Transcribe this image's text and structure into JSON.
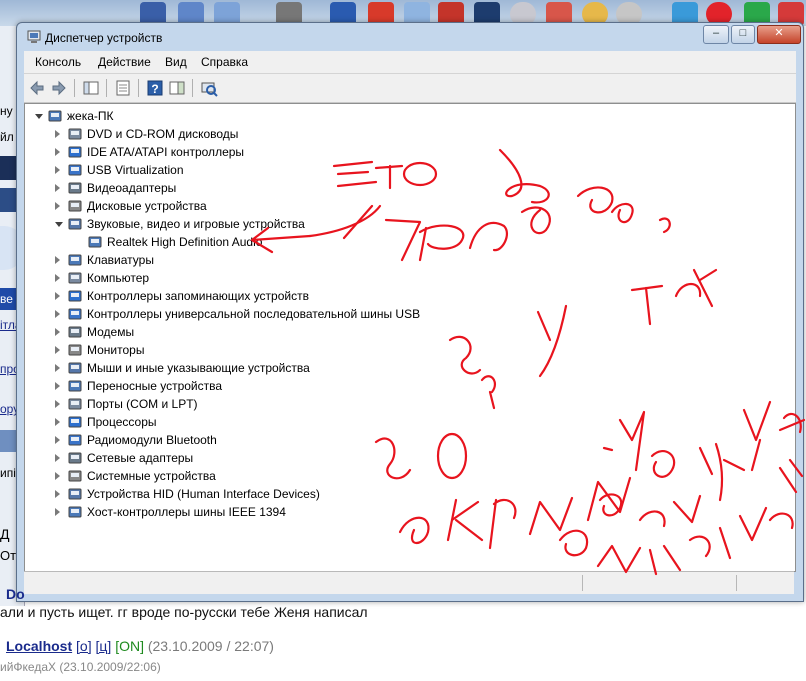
{
  "window": {
    "title": "Диспетчер устройств",
    "controls": {
      "minimize": "–",
      "maximize": "□",
      "close": "✕"
    }
  },
  "menu": [
    "Консоль",
    "Действие",
    "Вид",
    "Справка"
  ],
  "toolbar": [
    "back-icon",
    "forward-icon",
    "properties-icon",
    "console-tree-icon",
    "help-icon",
    "action-pane-icon",
    "scan-hardware-icon"
  ],
  "tree": {
    "root": "жека-ПК",
    "items": [
      {
        "label": "DVD и CD-ROM дисководы",
        "icon": "dvd-drive-icon"
      },
      {
        "label": "IDE ATA/ATAPI контроллеры",
        "icon": "ide-controller-icon"
      },
      {
        "label": "USB Virtualization",
        "icon": "usb-icon"
      },
      {
        "label": "Видеоадаптеры",
        "icon": "display-adapter-icon"
      },
      {
        "label": "Дисковые устройства",
        "icon": "disk-drive-icon"
      },
      {
        "label": "Звуковые, видео и игровые устройства",
        "icon": "sound-icon",
        "expanded": true,
        "children": [
          {
            "label": "Realtek High Definition Audio",
            "icon": "speaker-icon"
          }
        ]
      },
      {
        "label": "Клавиатуры",
        "icon": "keyboard-icon"
      },
      {
        "label": "Компьютер",
        "icon": "computer-icon"
      },
      {
        "label": "Контроллеры запоминающих устройств",
        "icon": "storage-controller-icon"
      },
      {
        "label": "Контроллеры универсальной последовательной шины USB",
        "icon": "usb-controller-icon"
      },
      {
        "label": "Модемы",
        "icon": "modem-icon"
      },
      {
        "label": "Мониторы",
        "icon": "monitor-icon"
      },
      {
        "label": "Мыши и иные указывающие устройства",
        "icon": "mouse-icon"
      },
      {
        "label": "Переносные устройства",
        "icon": "portable-device-icon"
      },
      {
        "label": "Порты (COM и LPT)",
        "icon": "port-icon"
      },
      {
        "label": "Процессоры",
        "icon": "processor-icon"
      },
      {
        "label": "Радиомодули Bluetooth",
        "icon": "bluetooth-icon"
      },
      {
        "label": "Сетевые адаптеры",
        "icon": "network-adapter-icon"
      },
      {
        "label": "Системные устройства",
        "icon": "system-device-icon"
      },
      {
        "label": "Устройства HID (Human Interface Devices)",
        "icon": "hid-icon"
      },
      {
        "label": "Хост-контроллеры шины IEEE 1394",
        "icon": "ieee1394-icon"
      }
    ]
  },
  "background_app": {
    "fragments": [
      "ну",
      "йл",
      "ве",
      "ітла",
      "про",
      "ору",
      "ипі",
      "Д",
      "От"
    ]
  },
  "chat": {
    "line1": "Do",
    "line2": "али и пусть ищет. гг вроде по-русски тебе Женя написал",
    "author": "Localhost",
    "link_o": "[о]",
    "link_ts": "[ц]",
    "status": "[ON]",
    "timestamp": "(23.10.2009 / 22:07)",
    "line4": "ийФкедаХ (23.10.2009/22:06)"
  },
  "colors": {
    "annotation": "#e8141e",
    "window_frame": "#c4d7ec",
    "link": "#1a2b8c",
    "online": "#1e8a1e"
  }
}
